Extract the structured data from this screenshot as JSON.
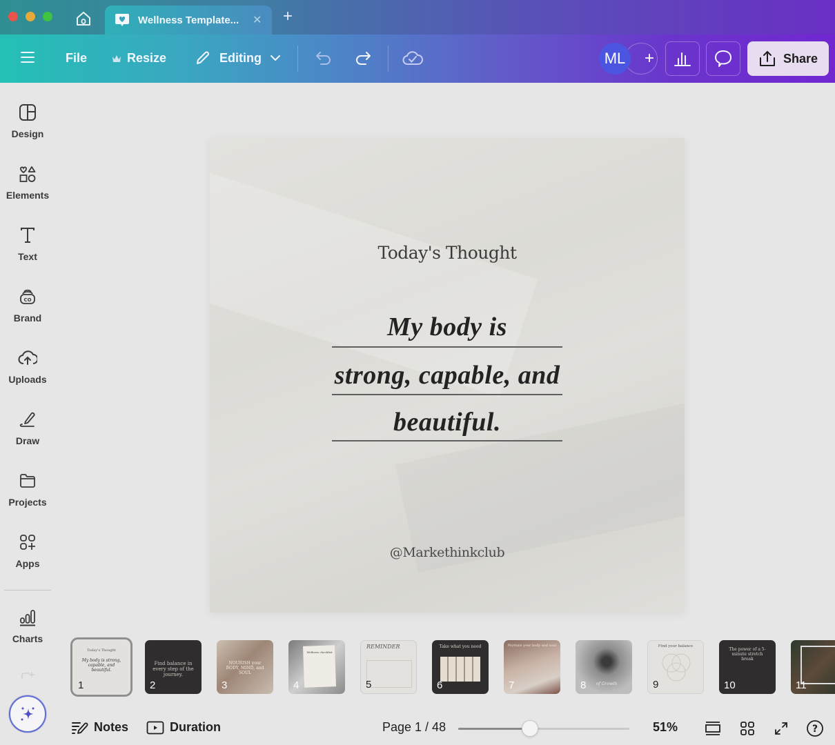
{
  "window": {
    "tab_title": "Wellness Template...",
    "tab_icon": "heart-chat-icon",
    "home_icon": "home-icon",
    "new_tab_label": "+"
  },
  "toolbar": {
    "menu_icon": "hamburger-icon",
    "file_label": "File",
    "resize_label": "Resize",
    "resize_icon": "crown-icon",
    "editing_label": "Editing",
    "editing_icon": "pencil-icon",
    "undo_icon": "undo-icon",
    "redo_icon": "redo-icon",
    "save_status_icon": "cloud-check-icon",
    "avatar_initials": "ML",
    "add_collaborator_label": "+",
    "insights_icon": "bar-chart-icon",
    "comments_icon": "speech-bubble-icon",
    "share_label": "Share",
    "share_icon": "upload-icon"
  },
  "sidebar": {
    "items": [
      {
        "label": "Design",
        "icon": "layout-icon"
      },
      {
        "label": "Elements",
        "icon": "shapes-icon"
      },
      {
        "label": "Text",
        "icon": "text-icon"
      },
      {
        "label": "Brand",
        "icon": "brand-icon"
      },
      {
        "label": "Uploads",
        "icon": "cloud-upload-icon"
      },
      {
        "label": "Draw",
        "icon": "draw-icon"
      },
      {
        "label": "Projects",
        "icon": "folder-icon"
      },
      {
        "label": "Apps",
        "icon": "apps-icon"
      },
      {
        "label": "Charts",
        "icon": "charts-icon"
      }
    ],
    "magic_icon": "sparkle-icon"
  },
  "page": {
    "heading": "Today's Thought",
    "lines": [
      "My body is",
      "strong, capable, and",
      "beautiful."
    ],
    "handle": "@Markethinkclub"
  },
  "thumbnails": [
    {
      "num": "1",
      "theme": "light",
      "text": "My body is strong, capable, and beautiful."
    },
    {
      "num": "2",
      "theme": "dark",
      "text": "Find balance in every step of the journey."
    },
    {
      "num": "3",
      "theme": "photo",
      "text": "NOURISH your BODY, MIND, and SOUL"
    },
    {
      "num": "4",
      "theme": "photo-gray",
      "text": "Wellness checklist"
    },
    {
      "num": "5",
      "theme": "light",
      "text": "REMINDER"
    },
    {
      "num": "6",
      "theme": "dark",
      "text": "Take what you need"
    },
    {
      "num": "7",
      "theme": "photo",
      "text": "Nurture your body and soul"
    },
    {
      "num": "8",
      "theme": "photo-gray",
      "text": "of Growth"
    },
    {
      "num": "9",
      "theme": "light",
      "text": "Find your balance"
    },
    {
      "num": "10",
      "theme": "dark",
      "text": "The power of a 5-minute stretch break"
    },
    {
      "num": "11",
      "theme": "photo-green",
      "text": ""
    }
  ],
  "bottombar": {
    "notes_label": "Notes",
    "duration_label": "Duration",
    "page_indicator": "Page 1 / 48",
    "zoom_percent": "51%",
    "zoom_fraction": 0.42,
    "view_icons": [
      "single-page-view-icon",
      "grid-view-icon",
      "fullscreen-icon",
      "help-icon"
    ]
  },
  "colors": {
    "avatar_bg": "#4c55e0",
    "share_bg": "#e8ddf0",
    "toolbar_start": "#24c0b6",
    "toolbar_end": "#7127d0"
  }
}
